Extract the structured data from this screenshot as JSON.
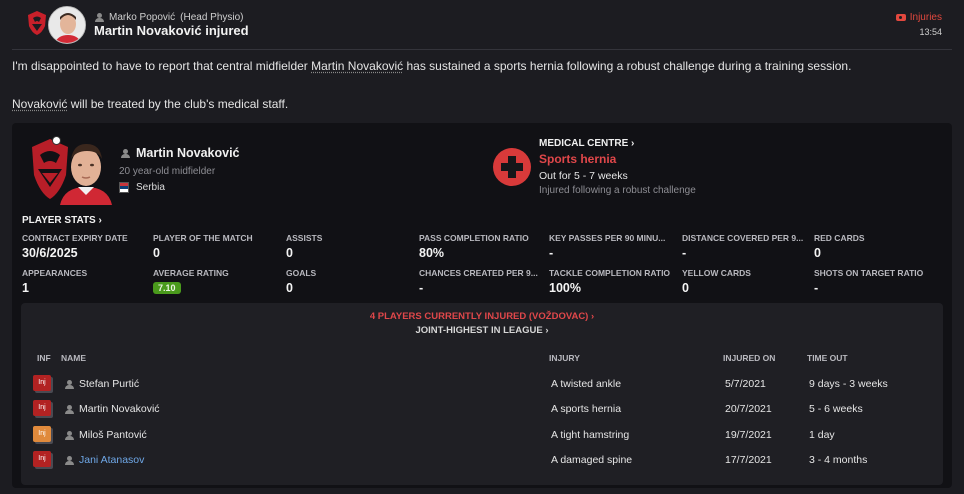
{
  "header": {
    "sender": "Marko Popović",
    "sender_role": "(Head Physio)",
    "title": "Martin Novaković injured",
    "tag": "Injuries",
    "time": "13:54"
  },
  "message": {
    "p1_a": "I'm disappointed to have to report that central midfielder ",
    "p1_name": "Martin Novaković",
    "p1_b": " has sustained a sports hernia following a robust challenge during a training session.",
    "p2_name": "Novaković",
    "p2_b": " will be treated by the club's medical staff."
  },
  "player": {
    "name": "Martin Novaković",
    "desc": "20 year-old midfielder",
    "nation": "Serbia"
  },
  "medical": {
    "title": "MEDICAL CENTRE",
    "injury": "Sports hernia",
    "out": "Out for 5 - 7 weeks",
    "cause": "Injured following a robust challenge"
  },
  "stats": {
    "title": "PLAYER STATS",
    "items": [
      {
        "label": "CONTRACT EXPIRY DATE",
        "value": "30/6/2025"
      },
      {
        "label": "PLAYER OF THE MATCH",
        "value": "0"
      },
      {
        "label": "ASSISTS",
        "value": "0"
      },
      {
        "label": "PASS COMPLETION RATIO",
        "value": "80%"
      },
      {
        "label": "KEY PASSES PER 90 MINU...",
        "value": "-"
      },
      {
        "label": "DISTANCE COVERED PER 9...",
        "value": "-"
      },
      {
        "label": "RED CARDS",
        "value": "0"
      },
      {
        "label": "APPEARANCES",
        "value": "1"
      },
      {
        "label": "AVERAGE RATING",
        "value": "7.10"
      },
      {
        "label": "GOALS",
        "value": "0"
      },
      {
        "label": "CHANCES CREATED PER 9...",
        "value": "-"
      },
      {
        "label": "TACKLE COMPLETION RATIO",
        "value": "100%"
      },
      {
        "label": "YELLOW CARDS",
        "value": "0"
      },
      {
        "label": "SHOTS ON TARGET RATIO",
        "value": "-"
      }
    ]
  },
  "injuries": {
    "title": "4 PLAYERS CURRENTLY INJURED (VOŽDOVAC)",
    "subtitle": "JOINT-HIGHEST IN LEAGUE",
    "headers": {
      "inf": "INF",
      "name": "NAME",
      "injury": "INJURY",
      "injured_on": "INJURED ON",
      "time_out": "TIME OUT"
    },
    "rows": [
      {
        "badge": "Inj",
        "color": "#b22222",
        "name": "Stefan Purtić",
        "injury": "A twisted ankle",
        "injured_on": "5/7/2021",
        "time_out": "9 days - 3 weeks"
      },
      {
        "badge": "Inj",
        "color": "#b22222",
        "name": "Martin Novaković",
        "injury": "A sports hernia",
        "injured_on": "20/7/2021",
        "time_out": "5 - 6 weeks"
      },
      {
        "badge": "Inj",
        "color": "#e08a3c",
        "name": "Miloš Pantović",
        "injury": "A tight hamstring",
        "injured_on": "19/7/2021",
        "time_out": "1 day"
      },
      {
        "badge": "Inj",
        "color": "#b22222",
        "name": "Jani Atanasov",
        "injury": "A damaged spine",
        "injured_on": "17/7/2021",
        "time_out": "3 - 4 months"
      }
    ]
  },
  "colors": {
    "accent_red": "#e0474a",
    "rating_green": "#4a9a1c",
    "link_blue": "#6fa8e8"
  }
}
